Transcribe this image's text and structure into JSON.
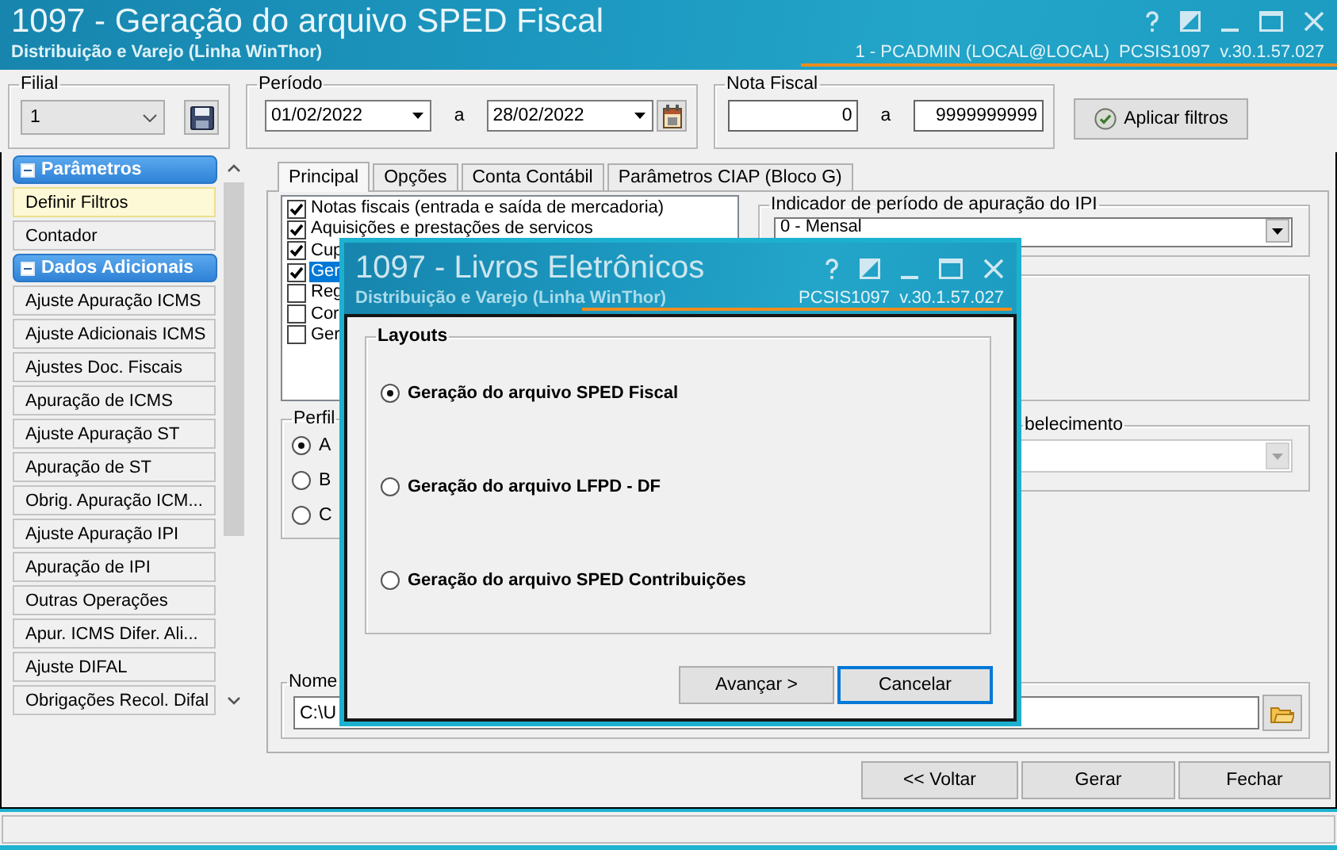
{
  "window": {
    "title": "1097 - Geração do arquivo SPED Fiscal",
    "subtitle": "Distribuição e Varejo (Linha WinThor)",
    "user": "1 - PCADMIN (LOCAL@LOCAL)",
    "version": "PCSIS1097  v.30.1.57.027"
  },
  "filters": {
    "filial": {
      "label": "Filial",
      "value": "1"
    },
    "periodo": {
      "label": "Período",
      "from": "01/02/2022",
      "separator": "a",
      "to": "28/02/2022"
    },
    "nota_fiscal": {
      "label": "Nota Fiscal",
      "from": "0",
      "separator": "a",
      "to": "9999999999"
    },
    "apply_button": "Aplicar filtros"
  },
  "sidebar": {
    "sections": [
      {
        "title": "Parâmetros",
        "expanded": true,
        "items": [
          {
            "label": "Definir Filtros",
            "selected": true
          },
          {
            "label": "Contador",
            "selected": false
          }
        ]
      },
      {
        "title": "Dados Adicionais",
        "expanded": true,
        "items": [
          {
            "label": "Ajuste Apuração ICMS",
            "selected": false
          },
          {
            "label": "Ajuste Adicionais ICMS",
            "selected": false
          },
          {
            "label": "Ajustes Doc. Fiscais",
            "selected": false
          },
          {
            "label": "Apuração de ICMS",
            "selected": false
          },
          {
            "label": "Ajuste Apuração ST",
            "selected": false
          },
          {
            "label": "Apuração de ST",
            "selected": false
          },
          {
            "label": "Obrig. Apuração ICM...",
            "selected": false
          },
          {
            "label": "Ajuste Apuração IPI",
            "selected": false
          },
          {
            "label": "Apuração de IPI",
            "selected": false
          },
          {
            "label": "Outras Operações",
            "selected": false
          },
          {
            "label": "Apur. ICMS Difer. Ali...",
            "selected": false
          },
          {
            "label": "Ajuste DIFAL",
            "selected": false
          },
          {
            "label": "Obrigações Recol. Difal",
            "selected": false
          }
        ]
      }
    ]
  },
  "tabs": [
    {
      "label": "Principal",
      "selected": true
    },
    {
      "label": "Opções",
      "selected": false
    },
    {
      "label": "Conta Contábil",
      "selected": false
    },
    {
      "label": "Parâmetros CIAP (Bloco G)",
      "selected": false
    }
  ],
  "principal": {
    "checklist": [
      {
        "label": "Notas fiscais (entrada e saída de mercadoria)",
        "checked": true,
        "selected": false
      },
      {
        "label": "Aquisições e prestações de servicos",
        "checked": true,
        "selected": false
      },
      {
        "label": "Cup",
        "checked": true,
        "selected": false
      },
      {
        "label": "Ger",
        "checked": true,
        "selected": true
      },
      {
        "label": "Reg",
        "checked": false,
        "selected": false
      },
      {
        "label": "Cor",
        "checked": false,
        "selected": false
      },
      {
        "label": "Ger",
        "checked": false,
        "selected": false
      }
    ],
    "ipi_period": {
      "label": "Indicador de período de apuração do IPI",
      "value": "0 - Mensal"
    },
    "perfil": {
      "label": "Perfil",
      "options": [
        {
          "label": "A",
          "selected": true
        },
        {
          "label": "B",
          "selected": false
        },
        {
          "label": "C",
          "selected": false
        }
      ]
    },
    "estabelecimento": {
      "label": "belecimento",
      "disabled": true
    },
    "file_name": {
      "label": "Nome",
      "value": "C:\\U"
    }
  },
  "footer_buttons": [
    "<< Voltar",
    "Gerar",
    "Fechar"
  ],
  "dialog": {
    "title": "1097 - Livros Eletrônicos",
    "subtitle": "Distribuição e Varejo (Linha WinThor)",
    "version": "PCSIS1097  v.30.1.57.027",
    "group": "Layouts",
    "options": [
      {
        "label": "Geração do arquivo SPED Fiscal",
        "selected": true
      },
      {
        "label": "Geração do arquivo LFPD - DF",
        "selected": false
      },
      {
        "label": "Geração do arquivo SPED Contribuições",
        "selected": false
      }
    ],
    "buttons": [
      {
        "label": "Avançar >",
        "focused": false
      },
      {
        "label": "Cancelar",
        "focused": true
      }
    ]
  }
}
